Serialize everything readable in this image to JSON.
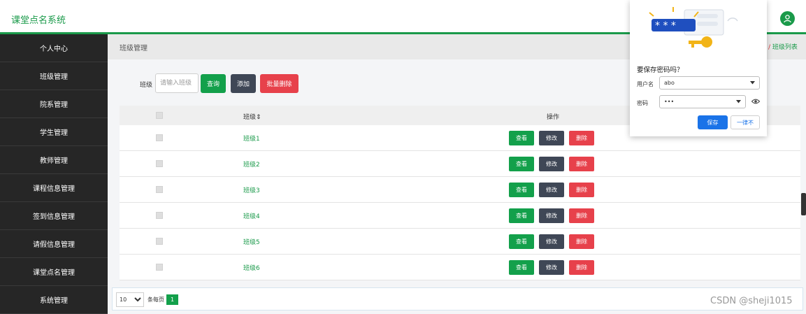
{
  "app": {
    "title": "课堂点名系统"
  },
  "sidebar": {
    "items": [
      {
        "label": "个人中心"
      },
      {
        "label": "班级管理"
      },
      {
        "label": "院系管理"
      },
      {
        "label": "学生管理"
      },
      {
        "label": "教师管理"
      },
      {
        "label": "课程信息管理"
      },
      {
        "label": "签到信息管理"
      },
      {
        "label": "请假信息管理"
      },
      {
        "label": "课堂点名管理"
      },
      {
        "label": "系统管理"
      }
    ]
  },
  "breadcrumb": {
    "title": "班级管理",
    "separator": "/",
    "current": "班级列表"
  },
  "search": {
    "label": "班级",
    "placeholder": "请输入班级",
    "query_label": "查询",
    "add_label": "添加",
    "batch_delete_label": "批量删除"
  },
  "table": {
    "headers": {
      "name": "班级⇕",
      "actions": "操作"
    },
    "rows": [
      {
        "name": "班级1"
      },
      {
        "name": "班级2"
      },
      {
        "name": "班级3"
      },
      {
        "name": "班级4"
      },
      {
        "name": "班级5"
      },
      {
        "name": "班级6"
      }
    ],
    "actions": {
      "view": "查看",
      "edit": "修改",
      "delete": "删除"
    }
  },
  "pagination": {
    "page_size": "10",
    "page_size_label": "条每页",
    "current_page": "1"
  },
  "password_popup": {
    "title": "要保存密码吗？",
    "username_label": "用户名",
    "username_value": "abo",
    "password_label": "密码",
    "password_value": "•••",
    "save_label": "保存",
    "never_label": "一律不",
    "illustration_text": "* * *"
  },
  "watermark": "CSDN @sheji1015",
  "colors": {
    "accent": "#1a9a4a",
    "sidebar": "#262626",
    "danger": "#e7414b",
    "dark_button": "#3f4756",
    "popup_primary": "#1a73e8"
  }
}
